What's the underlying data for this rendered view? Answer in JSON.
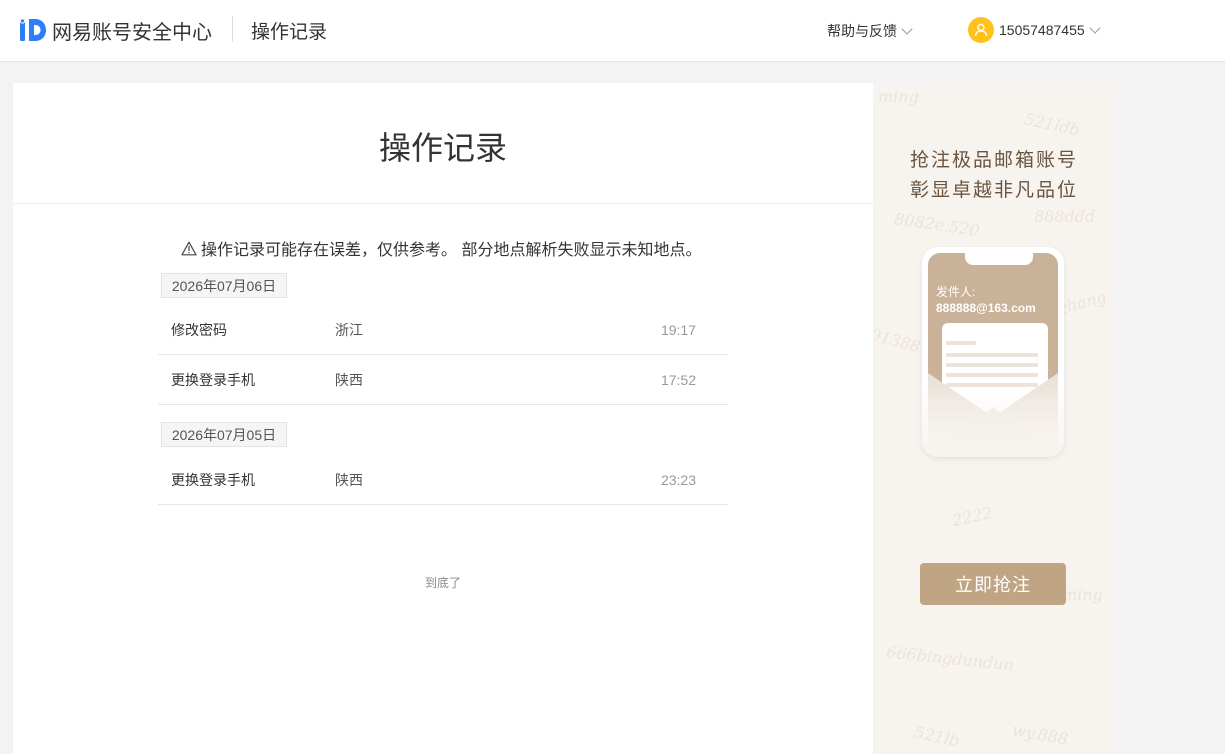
{
  "header": {
    "logo_text": "网易账号安全中心",
    "title": "操作记录",
    "help_label": "帮助与反馈",
    "phone": "15057487455"
  },
  "main": {
    "title": "操作记录",
    "notice": "操作记录可能存在误差，仅供参考。 部分地点解析失败显示未知地点。",
    "groups": [
      {
        "date": "2026年07月06日",
        "records": [
          {
            "action": "修改密码",
            "place": "浙江",
            "time": "19:17"
          },
          {
            "action": "更换登录手机",
            "place": "陕西",
            "time": "17:52"
          }
        ]
      },
      {
        "date": "2026年07月05日",
        "records": [
          {
            "action": "更换登录手机",
            "place": "陕西",
            "time": "23:23"
          }
        ]
      }
    ],
    "end_text": "到底了"
  },
  "ad": {
    "line1": "抢注极品邮箱账号",
    "line2": "彰显卓越非凡品位",
    "sender_label": "发件人:",
    "sender_email": "888888@163.com",
    "cta": "立即抢注",
    "watermarks": [
      "521ldb",
      "8082e.520",
      "888ddd",
      "01388",
      "2222",
      "666bingdundun",
      "521lb",
      "wy.888",
      "zhang",
      "ming"
    ]
  },
  "colors": {
    "accent": "#2d7ff9",
    "avatar": "#ffc21a",
    "ad_button": "#c0a584",
    "ad_text": "#6b5540"
  }
}
